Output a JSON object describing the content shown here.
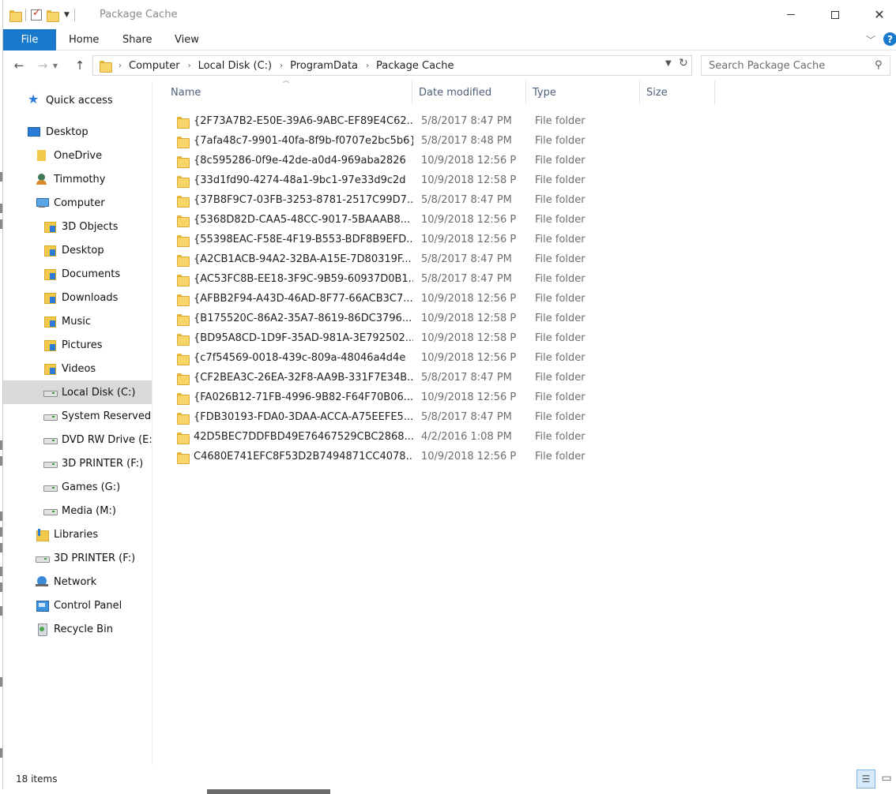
{
  "window": {
    "title": "Package Cache"
  },
  "ribbon": {
    "tabs": [
      "File",
      "Home",
      "Share",
      "View"
    ]
  },
  "address": {
    "breadcrumbs": [
      "Computer",
      "Local Disk (C:)",
      "ProgramData",
      "Package Cache"
    ]
  },
  "search": {
    "placeholder": "Search Package Cache"
  },
  "nav_pane": {
    "items": [
      {
        "label": "Quick access",
        "icon": "star-icon"
      },
      {
        "label": "Desktop",
        "icon": "desktop-icon"
      },
      {
        "label": "OneDrive",
        "icon": "onedrive-icon"
      },
      {
        "label": "Timmothy",
        "icon": "user-folder-icon"
      },
      {
        "label": "Computer",
        "icon": "computer-icon"
      },
      {
        "label": "3D Objects",
        "icon": "folder-icon"
      },
      {
        "label": "Desktop",
        "icon": "folder-icon"
      },
      {
        "label": "Documents",
        "icon": "folder-icon"
      },
      {
        "label": "Downloads",
        "icon": "folder-icon"
      },
      {
        "label": "Music",
        "icon": "folder-icon"
      },
      {
        "label": "Pictures",
        "icon": "folder-icon"
      },
      {
        "label": "Videos",
        "icon": "folder-icon"
      },
      {
        "label": "Local Disk (C:)",
        "icon": "drive-icon"
      },
      {
        "label": "System Reserved (I",
        "icon": "drive-icon"
      },
      {
        "label": "DVD RW Drive (E:)",
        "icon": "drive-icon"
      },
      {
        "label": "3D PRINTER (F:)",
        "icon": "drive-icon"
      },
      {
        "label": "Games (G:)",
        "icon": "drive-icon"
      },
      {
        "label": "Media (M:)",
        "icon": "drive-icon"
      },
      {
        "label": "Libraries",
        "icon": "libraries-icon"
      },
      {
        "label": "3D PRINTER (F:)",
        "icon": "drive-icon"
      },
      {
        "label": "Network",
        "icon": "network-icon"
      },
      {
        "label": "Control Panel",
        "icon": "control-panel-icon"
      },
      {
        "label": "Recycle Bin",
        "icon": "recycle-bin-icon"
      }
    ]
  },
  "columns": [
    "Name",
    "Date modified",
    "Type",
    "Size"
  ],
  "files": [
    {
      "name": "{2F73A7B2-E50E-39A6-9ABC-EF89E4C62...",
      "date": "5/8/2017 8:47 PM",
      "type": "File folder"
    },
    {
      "name": "{7afa48c7-9901-40fa-8f9b-f0707e2bc5b6}",
      "date": "5/8/2017 8:48 PM",
      "type": "File folder"
    },
    {
      "name": "{8c595286-0f9e-42de-a0d4-969aba2826",
      "date": "10/9/2018 12:56 P",
      "type": "File folder"
    },
    {
      "name": "{33d1fd90-4274-48a1-9bc1-97e33d9c2d",
      "date": "10/9/2018 12:58 P",
      "type": "File folder"
    },
    {
      "name": "{37B8F9C7-03FB-3253-8781-2517C99D7...",
      "date": "5/8/2017 8:47 PM",
      "type": "File folder"
    },
    {
      "name": "{5368D82D-CAA5-48CC-9017-5BAAAB8...",
      "date": "10/9/2018 12:56 P",
      "type": "File folder"
    },
    {
      "name": "{55398EAC-F58E-4F19-B553-BDF8B9EFD...",
      "date": "10/9/2018 12:56 P",
      "type": "File folder"
    },
    {
      "name": "{A2CB1ACB-94A2-32BA-A15E-7D80319F...",
      "date": "5/8/2017 8:47 PM",
      "type": "File folder"
    },
    {
      "name": "{AC53FC8B-EE18-3F9C-9B59-60937D0B1...",
      "date": "5/8/2017 8:47 PM",
      "type": "File folder"
    },
    {
      "name": "{AFBB2F94-A43D-46AD-8F77-66ACB3C7...",
      "date": "10/9/2018 12:56 P",
      "type": "File folder"
    },
    {
      "name": "{B175520C-86A2-35A7-8619-86DC3796...",
      "date": "10/9/2018 12:58 P",
      "type": "File folder"
    },
    {
      "name": "{BD95A8CD-1D9F-35AD-981A-3E792502...",
      "date": "10/9/2018 12:58 P",
      "type": "File folder"
    },
    {
      "name": "{c7f54569-0018-439c-809a-48046a4d4e",
      "date": "10/9/2018 12:56 P",
      "type": "File folder"
    },
    {
      "name": "{CF2BEA3C-26EA-32F8-AA9B-331F7E34B...",
      "date": "5/8/2017 8:47 PM",
      "type": "File folder"
    },
    {
      "name": "{FA026B12-71FB-4996-9B82-F64F70B06...",
      "date": "10/9/2018 12:56 P",
      "type": "File folder"
    },
    {
      "name": "{FDB30193-FDA0-3DAA-ACCA-A75EEFE5...",
      "date": "5/8/2017 8:47 PM",
      "type": "File folder"
    },
    {
      "name": "42D5BEC7DDFBD49E76467529CBC2868...",
      "date": "4/2/2016 1:08 PM",
      "type": "File folder"
    },
    {
      "name": "C4680E741EFC8F53D2B7494871CC4078...",
      "date": "10/9/2018 12:56 P",
      "type": "File folder"
    }
  ],
  "status": {
    "item_count": "18 items"
  },
  "colors": {
    "accent": "#1979ca",
    "selected_nav": "#d9d9d9",
    "header_text": "#4c607a",
    "folder": "#f8d56b"
  }
}
